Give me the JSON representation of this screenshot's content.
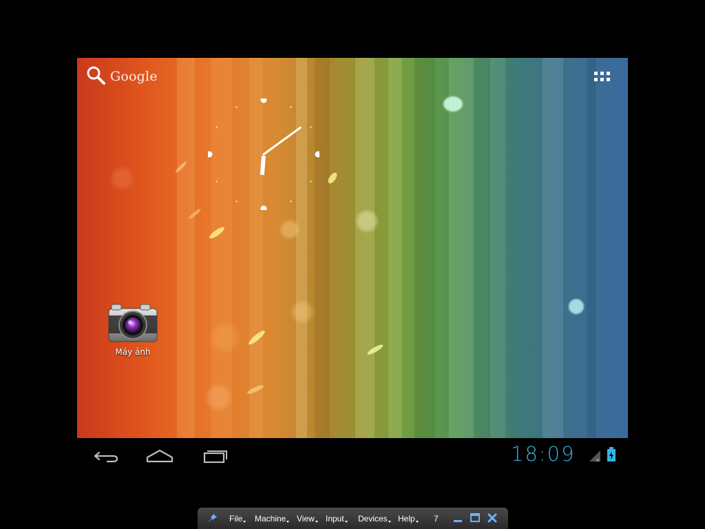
{
  "launcher": {
    "search_label": "Google",
    "apps_button": "all-apps-grid-icon"
  },
  "clock_widget": {
    "hour": 6,
    "minute": 9
  },
  "shortcuts": [
    {
      "label": "Máy ảnh",
      "icon": "camera-icon"
    }
  ],
  "system_bar": {
    "time": "18:09",
    "time_color": "#33b5e5",
    "buttons": [
      "back-icon",
      "home-icon",
      "recent-apps-icon"
    ],
    "status_icons": [
      "signal-icon",
      "battery-icon"
    ]
  },
  "vbox_toolbar": {
    "menus": [
      "File",
      "Machine",
      "View",
      "Input",
      "Devices",
      "Help"
    ],
    "screen_number": "7",
    "icons": [
      "pin-icon",
      "minimize-icon",
      "restore-icon",
      "close-icon"
    ]
  }
}
